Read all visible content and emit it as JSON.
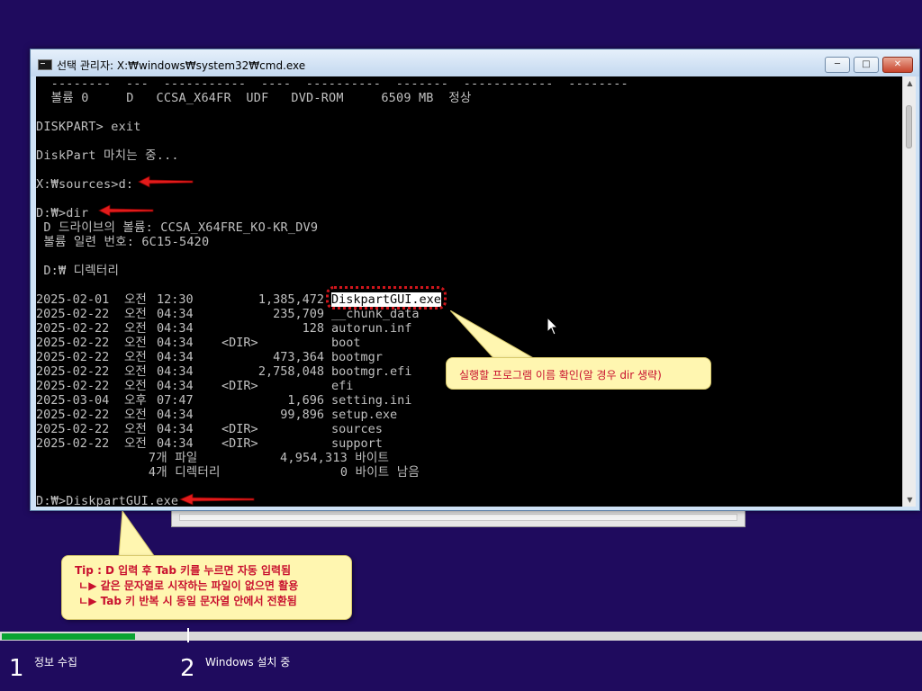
{
  "window": {
    "title": "선택 관리자: X:₩windows₩system32₩cmd.exe",
    "min_label": "─",
    "max_label": "□",
    "close_label": "✕"
  },
  "console": {
    "lines": [
      "  --------  ---  -----------  ----  ----------  -------  ------------  --------",
      "  볼륨 0     D   CCSA_X64FR  UDF   DVD-ROM     6509 MB  정상",
      "",
      "DISKPART> exit",
      "",
      "DiskPart 마치는 중...",
      "",
      "X:₩sources>d:",
      "",
      "D:₩>dir",
      " D 드라이브의 볼륨: CCSA_X64FRE_KO-KR_DV9",
      " 볼륨 일련 번호: 6C15-5420",
      "",
      " D:₩ 디렉터리",
      ""
    ],
    "dir_rows": [
      {
        "date": "2025-02-01",
        "ampm": "오전",
        "time": "12:30",
        "dir": "",
        "size": "1,385,472",
        "name": "DiskpartGUI.exe"
      },
      {
        "date": "2025-02-22",
        "ampm": "오전",
        "time": "04:34",
        "dir": "",
        "size": "235,709",
        "name": "__chunk_data"
      },
      {
        "date": "2025-02-22",
        "ampm": "오전",
        "time": "04:34",
        "dir": "",
        "size": "128",
        "name": "autorun.inf"
      },
      {
        "date": "2025-02-22",
        "ampm": "오전",
        "time": "04:34",
        "dir": "<DIR>",
        "size": "",
        "name": "boot"
      },
      {
        "date": "2025-02-22",
        "ampm": "오전",
        "time": "04:34",
        "dir": "",
        "size": "473,364",
        "name": "bootmgr"
      },
      {
        "date": "2025-02-22",
        "ampm": "오전",
        "time": "04:34",
        "dir": "",
        "size": "2,758,048",
        "name": "bootmgr.efi"
      },
      {
        "date": "2025-02-22",
        "ampm": "오전",
        "time": "04:34",
        "dir": "<DIR>",
        "size": "",
        "name": "efi"
      },
      {
        "date": "2025-03-04",
        "ampm": "오후",
        "time": "07:47",
        "dir": "",
        "size": "1,696",
        "name": "setting.ini"
      },
      {
        "date": "2025-02-22",
        "ampm": "오전",
        "time": "04:34",
        "dir": "",
        "size": "99,896",
        "name": "setup.exe"
      },
      {
        "date": "2025-02-22",
        "ampm": "오전",
        "time": "04:34",
        "dir": "<DIR>",
        "size": "",
        "name": "sources"
      },
      {
        "date": "2025-02-22",
        "ampm": "오전",
        "time": "04:34",
        "dir": "<DIR>",
        "size": "",
        "name": "support"
      }
    ],
    "summary_files": "               7개 파일           4,954,313 바이트",
    "summary_dirs": "               4개 디렉터리                0 바이트 남음",
    "prompt": "D:₩>DiskpartGUI.exe"
  },
  "callouts": {
    "program": "실행할 프로그램 이름 확인(알 경우 dir 생략)",
    "tip_line1": "Tip : D 입력 후 Tab 키를 누르면 자동 입력됨",
    "tip_line2": " ㄴ▶ 같은 문자열로 시작하는 파일이 없으면 활용",
    "tip_line3": " ㄴ▶ Tab 키 반복 시 동일 문자열 안에서 전환됨"
  },
  "setup": {
    "progress": 0.145,
    "steps": [
      {
        "num": "1",
        "label": "정보 수집"
      },
      {
        "num": "2",
        "label": "Windows 설치 중"
      }
    ]
  },
  "colors": {
    "background": "#1f0b5e",
    "progress_fill": "#0aa332",
    "annotation_red": "#c8102e",
    "callout_bg": "#fff6b0"
  }
}
